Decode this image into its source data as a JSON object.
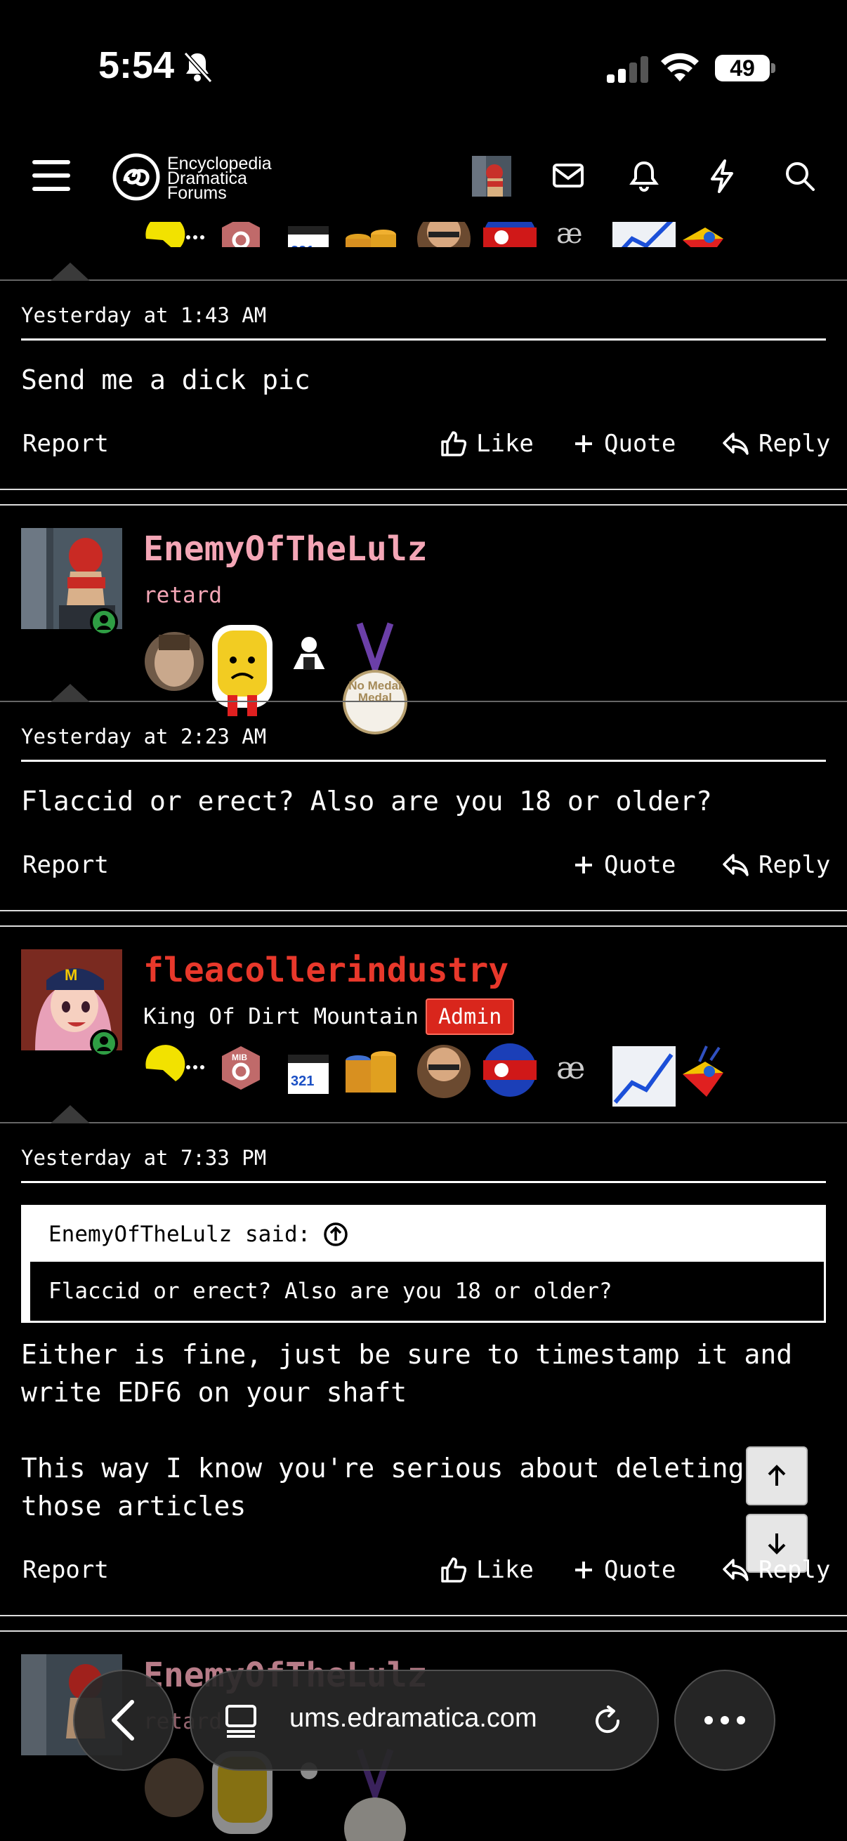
{
  "status": {
    "time": "5:54",
    "battery": "49"
  },
  "header": {
    "logo_line1": "Encyclopedia",
    "logo_line2": "Dramatica",
    "logo_line3": "Forums"
  },
  "posts": [
    {
      "timestamp": "Yesterday at 1:43 AM",
      "body": "Send me a dick pic",
      "actions": {
        "report": "Report",
        "like": "Like",
        "quote": "Quote",
        "reply": "Reply"
      }
    },
    {
      "username": "EnemyOfTheLulz",
      "usertitle": "retard",
      "timestamp": "Yesterday at 2:23 AM",
      "body": "Flaccid or erect? Also are you 18 or older?",
      "actions": {
        "report": "Report",
        "quote": "Quote",
        "reply": "Reply"
      },
      "medal_text": "No Medal Medal"
    },
    {
      "username": "fleacollerindustry",
      "usertitle": "King Of Dirt Mountain",
      "badge": "Admin",
      "timestamp": "Yesterday at 7:33 PM",
      "quote_author": "EnemyOfTheLulz said:",
      "quote_text": "Flaccid or erect? Also are you 18 or older?",
      "body": "Either is fine, just be sure to timestamp it and\nwrite EDF6 on your shaft\n\nThis way I know you're serious about deleting\nthose articles",
      "actions": {
        "report": "Report",
        "like": "Like",
        "quote": "Quote",
        "reply": "Reply"
      }
    },
    {
      "username": "EnemyOfTheLulz",
      "usertitle": "retard"
    }
  ],
  "browser": {
    "url": "ums.edramatica.com"
  },
  "colors": {
    "pink_user": "#f4a6b6",
    "red_user": "#e8382b",
    "admin_badge": "#d9261c"
  }
}
